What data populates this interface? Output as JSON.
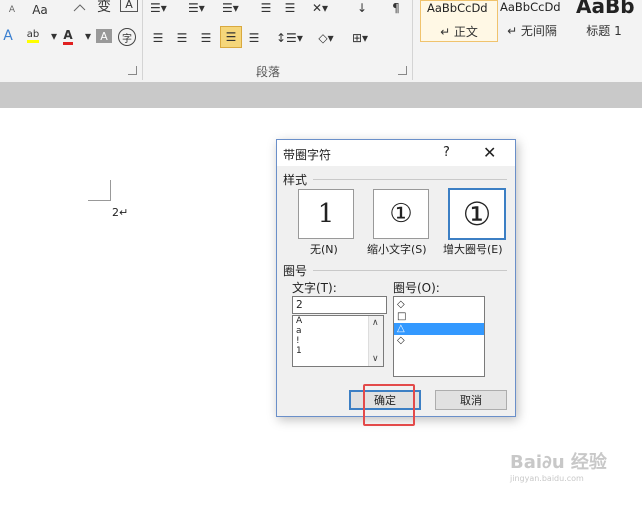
{
  "ribbon": {
    "font_buttons": {
      "font_size_a": "A",
      "case_button": "Aa"
    },
    "icons": {
      "text_effect": "A",
      "highlight": "ab",
      "font_color": "A",
      "char_shading": "A",
      "enclose_char": "字"
    },
    "paragraph_label": "段落",
    "styles": [
      {
        "preview": "AaBbCcDd",
        "name": "↵ 正文",
        "active": true
      },
      {
        "preview": "AaBbCcDd",
        "name": "↵ 无间隔",
        "active": false
      },
      {
        "preview": "AaBb",
        "name": "标题 1",
        "active": false
      }
    ]
  },
  "document": {
    "text": "2↵"
  },
  "dialog": {
    "title": "带圈字符",
    "help": "?",
    "close": "✕",
    "style_section": "样式",
    "options": [
      {
        "glyph": "1",
        "label": "无(N)"
      },
      {
        "glyph": "①",
        "label": "缩小文字(S)"
      },
      {
        "glyph": "①",
        "label": "增大圈号(E)",
        "selected": true
      }
    ],
    "circle_section": "圈号",
    "text_label": "文字(T):",
    "text_value": "2",
    "text_list": [
      "A",
      "a",
      "!",
      "1"
    ],
    "circle_label": "圈号(O):",
    "circle_list": [
      "◇",
      "□",
      "△",
      "◇"
    ],
    "circle_selected_index": 2,
    "ok": "确定",
    "cancel": "取消"
  },
  "watermark": {
    "line1": "Bai∂u 经验",
    "line2": "jingyan.baidu.com"
  }
}
